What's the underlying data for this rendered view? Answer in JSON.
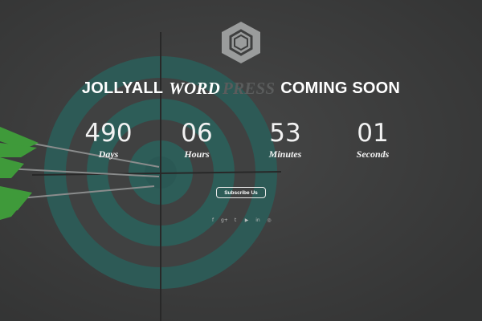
{
  "headline": {
    "word1": "JOLLYALL",
    "word2": "WORD",
    "word3": "PRESS",
    "word4": "COMING SOON"
  },
  "countdown": [
    {
      "value": "490",
      "label": "Days"
    },
    {
      "value": "06",
      "label": "Hours"
    },
    {
      "value": "53",
      "label": "Minutes"
    },
    {
      "value": "01",
      "label": "Seconds"
    }
  ],
  "subscribe_label": "Subscribe Us",
  "social": [
    {
      "icon": "facebook-icon",
      "glyph": "f"
    },
    {
      "icon": "google-plus-icon",
      "glyph": "g+"
    },
    {
      "icon": "twitter-icon",
      "glyph": "t"
    },
    {
      "icon": "youtube-icon",
      "glyph": "▶"
    },
    {
      "icon": "linkedin-icon",
      "glyph": "in"
    },
    {
      "icon": "dribbble-icon",
      "glyph": "◎"
    }
  ],
  "colors": {
    "background": "#3e3f3f",
    "target_ring": "#1f6f67",
    "fletching": "#3f9a3a"
  }
}
